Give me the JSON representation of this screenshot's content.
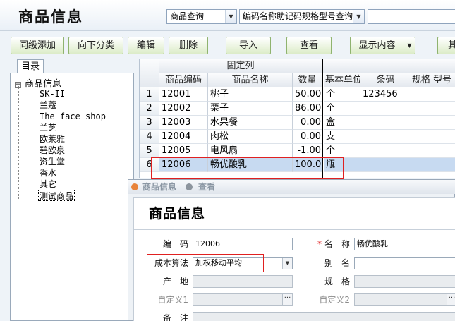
{
  "header": {
    "title": "商品信息",
    "query_select": "商品查询",
    "field_select": "编码名称助记码规格型号查询",
    "search_value": ""
  },
  "toolbar": {
    "buttons": [
      "同级添加",
      "向下分类",
      "编辑",
      "删除",
      "导入",
      "查看",
      "显示内容",
      "其"
    ]
  },
  "tree": {
    "tab": "目录",
    "root": "商品信息",
    "root_toggle": "−",
    "nodes": [
      "SK-II",
      "兰蔻",
      "The face shop",
      "兰芝",
      "欧莱雅",
      "碧欧泉",
      "资生堂",
      "香水",
      "其它",
      "测试商品"
    ],
    "selected_index": 9
  },
  "grid": {
    "group_header": "固定列",
    "columns": [
      "商品编码",
      "商品名称",
      "数量",
      "基本单位",
      "条码",
      "规格",
      "型号"
    ],
    "rows": [
      {
        "num": "1",
        "code": "12001",
        "name": "桃子",
        "qty": "50.00",
        "unit": "个",
        "barcode": "123456"
      },
      {
        "num": "2",
        "code": "12002",
        "name": "栗子",
        "qty": "86.00",
        "unit": "个",
        "barcode": ""
      },
      {
        "num": "3",
        "code": "12003",
        "name": "水果餐",
        "qty": "0.00",
        "unit": "盒",
        "barcode": ""
      },
      {
        "num": "4",
        "code": "12004",
        "name": "肉松",
        "qty": "0.00",
        "unit": "支",
        "barcode": ""
      },
      {
        "num": "5",
        "code": "12005",
        "name": "电风扇",
        "qty": "-1.00",
        "unit": "个",
        "barcode": ""
      },
      {
        "num": "6",
        "code": "12006",
        "name": "畅优酸乳",
        "qty": "100.00",
        "unit": "瓶",
        "barcode": ""
      }
    ],
    "selected_row": 5
  },
  "dialog": {
    "title": "商品信息",
    "title_tab2": "查看",
    "heading": "商品信息",
    "code_label": "编　码",
    "code_value": "12006",
    "name_label": "名　称",
    "name_required": "*",
    "name_value": "畅优酸乳",
    "cost_label": "成本算法",
    "cost_value": "加权移动平均",
    "alias_label": "别　名",
    "alias_value": "",
    "origin_label": "产　地",
    "spec_label": "规　格",
    "custom1_label": "自定义1",
    "custom2_label": "自定义2",
    "remark_label": "备　注"
  },
  "colors": {
    "accent_red": "#e02020",
    "selected_row": "#c7daf1",
    "button_border": "#8fb36f"
  }
}
